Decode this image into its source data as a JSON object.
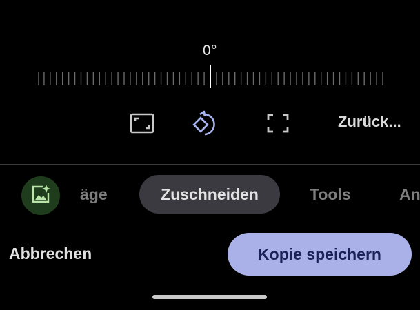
{
  "crop": {
    "angle_label": "0°",
    "tools": {
      "aspect_ratio_icon": "aspect-ratio-icon",
      "rotate_icon": "rotate-icon",
      "free_crop_icon": "free-crop-icon"
    },
    "reset_label": "Zurück..."
  },
  "tabs": {
    "magic_icon": "magic-editor-icon",
    "partial_left": "äge",
    "active": "Zuschneiden",
    "tools": "Tools",
    "partial_right": "An"
  },
  "actions": {
    "cancel_label": "Abbrechen",
    "save_copy_label": "Kopie speichern"
  },
  "colors": {
    "background": "#000000",
    "rotate_accent": "#a8b4f0",
    "magic_button_bg": "#1f3d1c",
    "magic_icon": "#b9e6a8",
    "active_tab_bg": "#3b3a40",
    "save_button_bg": "#aab1e8",
    "save_button_text": "#1a2257"
  }
}
